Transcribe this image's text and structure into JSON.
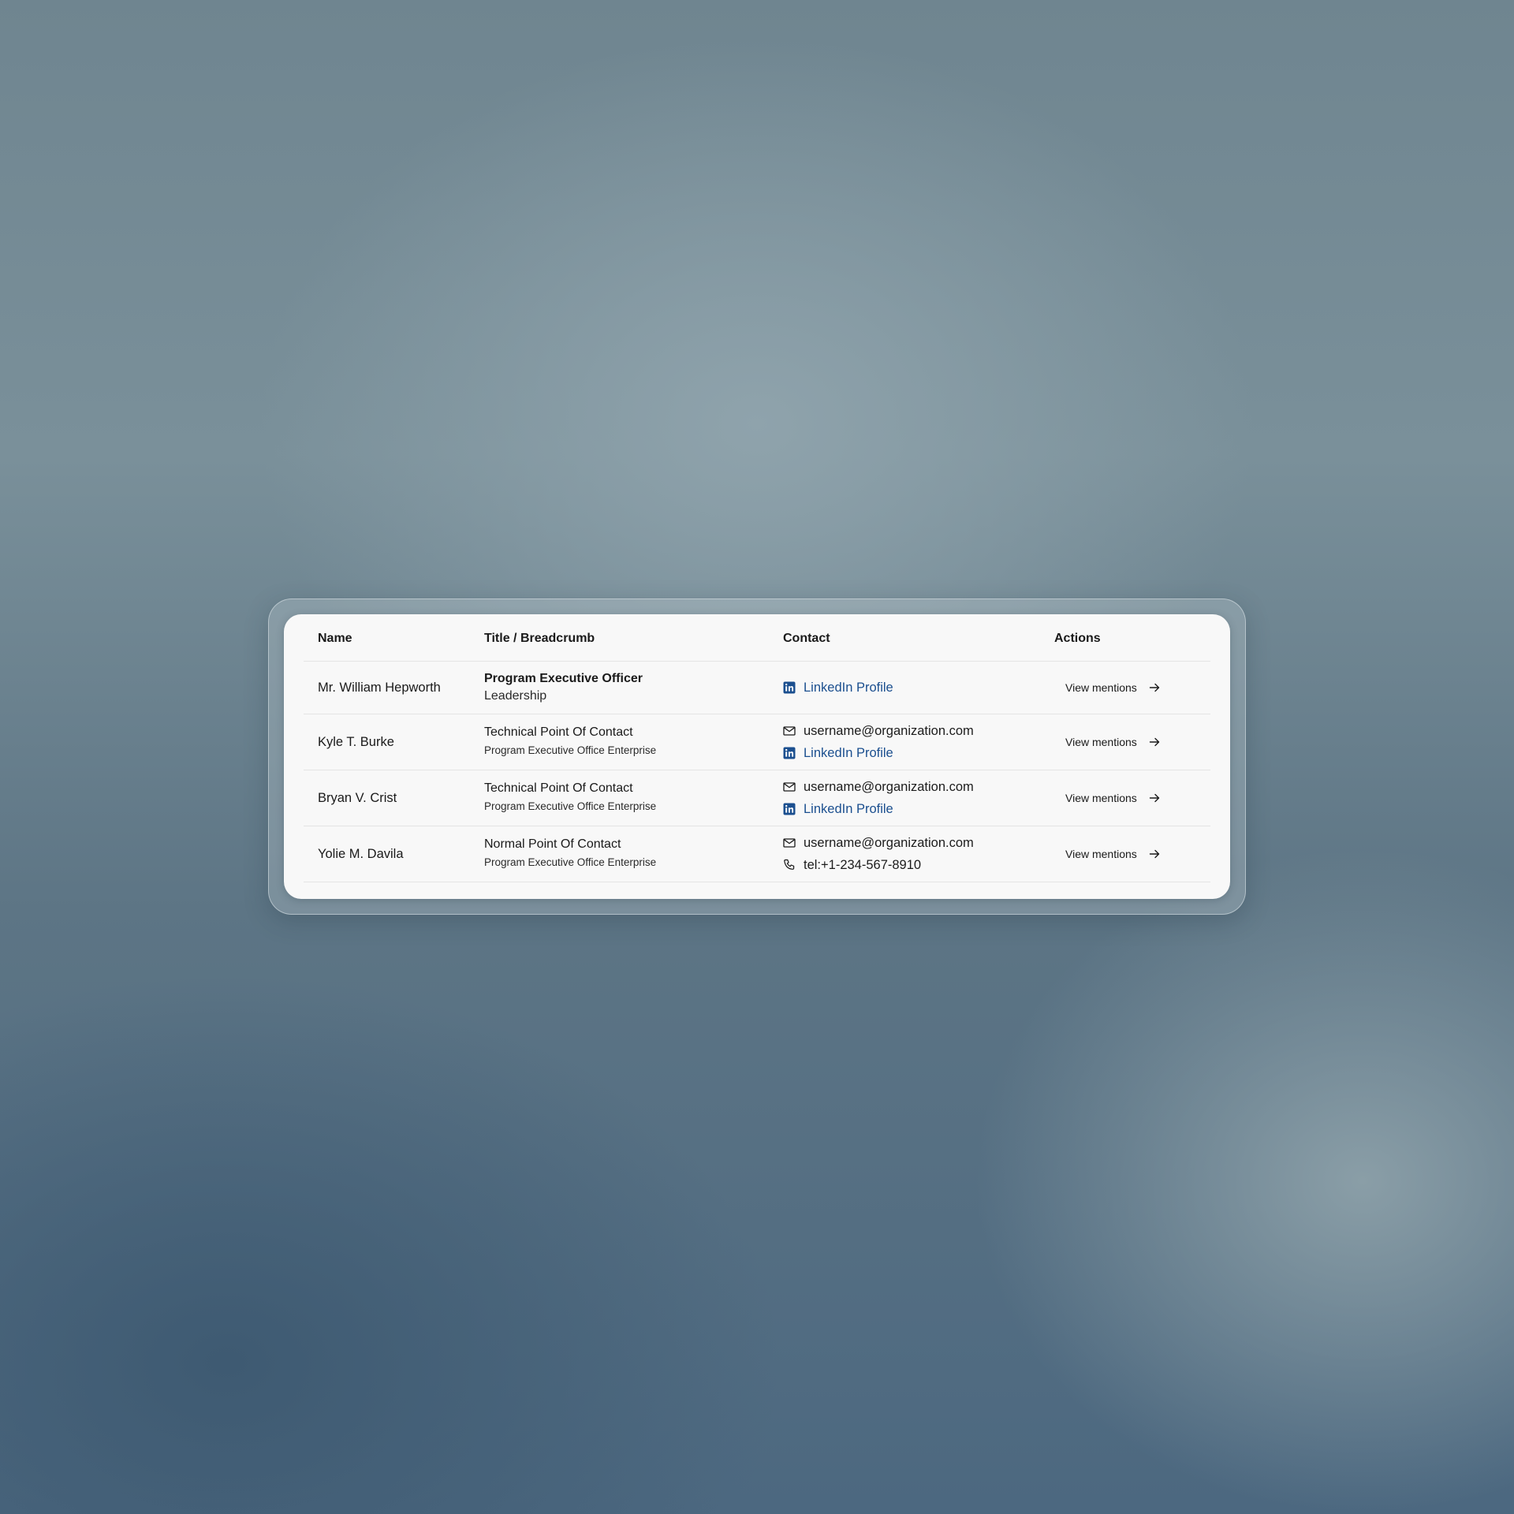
{
  "table": {
    "headers": {
      "name": "Name",
      "title": "Title / Breadcrumb",
      "contact": "Contact",
      "actions": "Actions"
    },
    "rows": [
      {
        "name": "Mr. William Hepworth",
        "title": "Program Executive Officer",
        "breadcrumb": "Leadership",
        "email": "",
        "phone": "",
        "linkedin": "LinkedIn Profile",
        "action": "View mentions"
      },
      {
        "name": "Kyle T. Burke",
        "title": "Technical Point Of Contact",
        "breadcrumb": "Program Executive Office Enterprise",
        "email": "username@organization.com",
        "phone": "",
        "linkedin": "LinkedIn Profile",
        "action": "View mentions"
      },
      {
        "name": "Bryan V. Crist",
        "title": "Technical Point Of Contact",
        "breadcrumb": "Program Executive Office Enterprise",
        "email": "username@organization.com",
        "phone": "",
        "linkedin": "LinkedIn Profile",
        "action": "View mentions"
      },
      {
        "name": "Yolie M. Davila",
        "title": "Normal Point Of Contact",
        "breadcrumb": "Program Executive Office Enterprise",
        "email": "username@organization.com",
        "phone": "tel:+1-234-567-8910",
        "linkedin": "",
        "action": "View mentions"
      }
    ]
  },
  "icons": {
    "email": "mail-icon",
    "phone": "phone-icon",
    "linkedin": "linkedin-icon",
    "action": "arrow-right-icon"
  },
  "colors": {
    "linkedin_link": "#1b4f8f",
    "card_background": "#f8f8f8"
  }
}
